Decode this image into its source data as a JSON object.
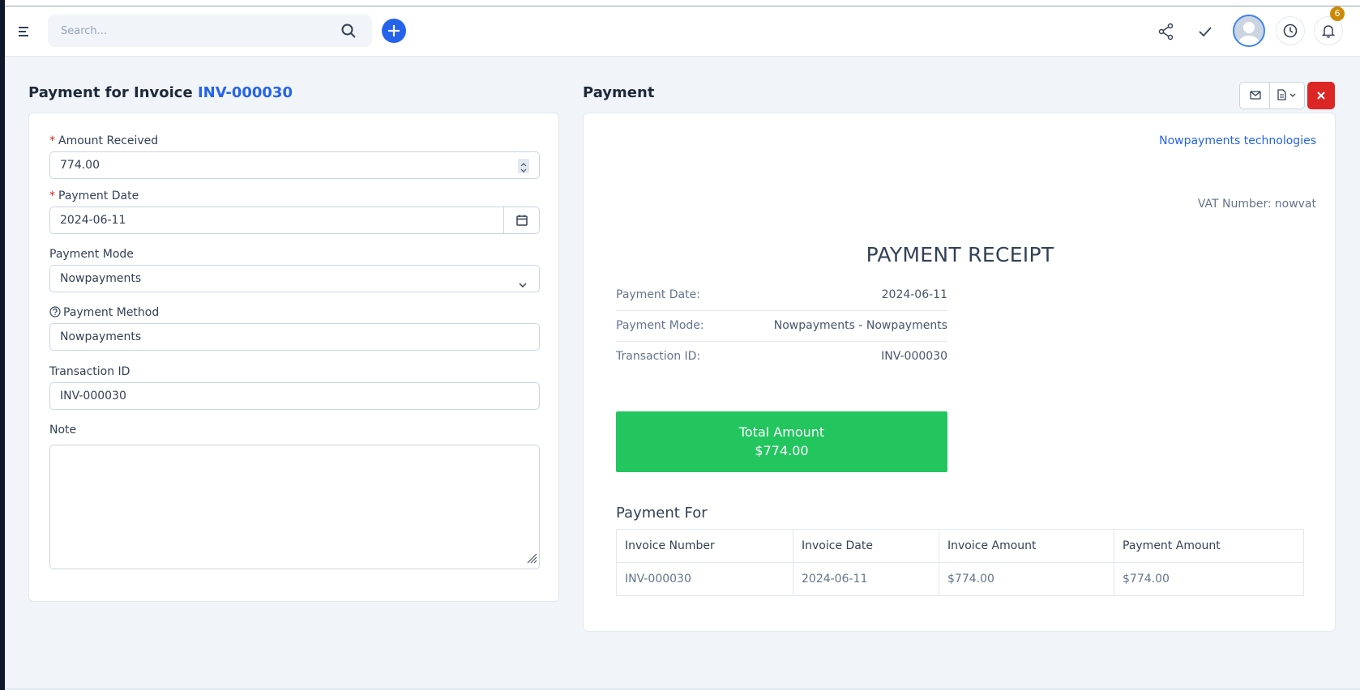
{
  "topbar": {
    "search_placeholder": "Search...",
    "notification_count": "6",
    "accent": "#2563eb",
    "badge_color": "#ca8a04"
  },
  "form": {
    "title_prefix": "Payment for Invoice",
    "invoice_number": "INV-000030",
    "amount_label": "Amount Received",
    "amount_value": "774.00",
    "date_label": "Payment Date",
    "date_value": "2024-06-11",
    "mode_label": "Payment Mode",
    "mode_value": "Nowpayments",
    "method_label": "Payment Method",
    "method_value": "Nowpayments",
    "txn_label": "Transaction ID",
    "txn_value": "INV-000030",
    "note_label": "Note",
    "required_mark": "*"
  },
  "receipt": {
    "panel_title": "Payment",
    "company": "Nowpayments technologies",
    "vat_label": "VAT Number:",
    "vat_value": "nowvat",
    "title": "PAYMENT RECEIPT",
    "rows": [
      {
        "label": "Payment Date:",
        "value": "2024-06-11"
      },
      {
        "label": "Payment Mode:",
        "value": "Nowpayments - Nowpayments"
      },
      {
        "label": "Transaction ID:",
        "value": "INV-000030"
      }
    ],
    "total_label": "Total Amount",
    "total_value": "$774.00",
    "total_color": "#22c55e",
    "payment_for_title": "Payment For",
    "table_headers": [
      "Invoice Number",
      "Invoice Date",
      "Invoice Amount",
      "Payment Amount"
    ],
    "table_rows": [
      [
        "INV-000030",
        "2024-06-11",
        "$774.00",
        "$774.00"
      ]
    ],
    "close_color": "#dc2626"
  }
}
